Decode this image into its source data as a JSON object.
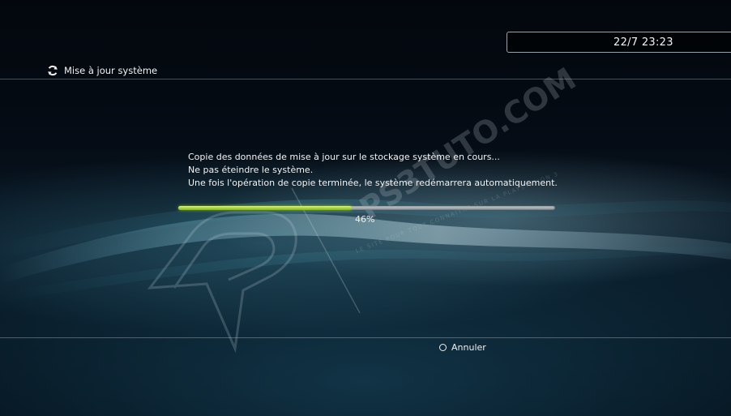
{
  "header": {
    "clock": "22/7 23:23",
    "title": "Mise à jour système",
    "title_icon": "update-arrows-icon"
  },
  "dialog": {
    "lines": [
      "Copie des données de mise à jour sur le stockage système en cours...",
      "Ne pas éteindre le système.",
      "Une fois l'opération de copie terminée, le système redémarrera automatiquement."
    ],
    "progress": 0.46,
    "progress_label": "46%"
  },
  "footer": {
    "cancel_icon": "circle-button-icon",
    "cancel_label": "Annuler"
  },
  "watermark": {
    "brand": "PS3TUTO.COM",
    "tagline": "LE SITE POUR TOUT CONNAITRE SUR LA PLAYSTATION 3"
  },
  "colors": {
    "progress_fill": "#a6d22e",
    "progress_track": "#b4bcc1",
    "background": "#050c15"
  }
}
